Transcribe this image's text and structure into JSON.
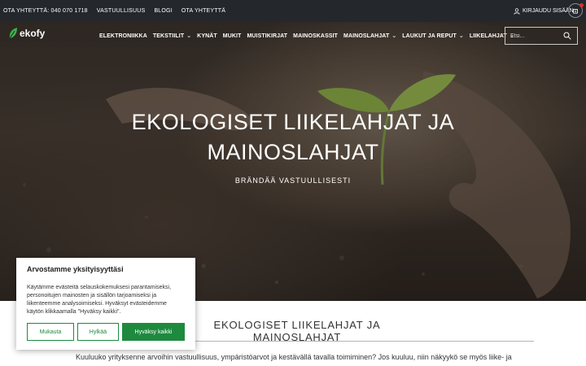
{
  "topbar": {
    "links": [
      "OTA YHTEYTTÄ: 040 070 1718",
      "VASTUULLISUUS",
      "BLOGI",
      "OTA YHTEYTTÄ"
    ],
    "login_label": "KIRJAUDU SISÄÄN"
  },
  "header": {
    "logo_text": "ekofy",
    "nav": [
      {
        "label": "ELEKTRONIIKKA",
        "dropdown": false
      },
      {
        "label": "TEKSTIILIT",
        "dropdown": true
      },
      {
        "label": "KYNÄT",
        "dropdown": false
      },
      {
        "label": "MUKIT",
        "dropdown": false
      },
      {
        "label": "MUISTIKIRJAT",
        "dropdown": false
      },
      {
        "label": "MAINOSKASSIT",
        "dropdown": false
      },
      {
        "label": "MAINOSLAHJAT",
        "dropdown": true
      },
      {
        "label": "LAUKUT JA REPUT",
        "dropdown": true
      },
      {
        "label": "LIIKELAHJAT",
        "dropdown": true
      }
    ],
    "search_placeholder": "Etsi..."
  },
  "hero": {
    "title_line1": "EKOLOGISET LIIKELAHJAT JA",
    "title_line2": "MAINOSLAHJAT",
    "subtitle": "BRÄNDÄÄ VASTUULLISESTI"
  },
  "content": {
    "title": "EKOLOGISET LIIKELAHJAT JA MAINOSLAHJAT",
    "paragraph": "Kuuluuko yrityksenne arvoihin vastuullisuus, ympäristöarvot ja kestävällä tavalla toimiminen? Jos kuuluu, niin näkyykö se myös liike- ja"
  },
  "cookie": {
    "title": "Arvostamme yksityisyyttäsi",
    "text": "Käytämme evästeitä selauskokemuksesi parantamiseksi, personoitujen mainosten ja sisällön tarjoamiseksi ja liikenteemme analysoimiseksi. Hyväksyt evästeidemme käytön klikkaamalla \"Hyväksy kaikki\".",
    "customize_label": "Mukauta",
    "reject_label": "Hylkää",
    "accept_label": "Hyväksy kaikki"
  },
  "colors": {
    "topbar": "#24272b",
    "accent_green": "#1e8a3e",
    "cart_badge": "#d9342b"
  }
}
